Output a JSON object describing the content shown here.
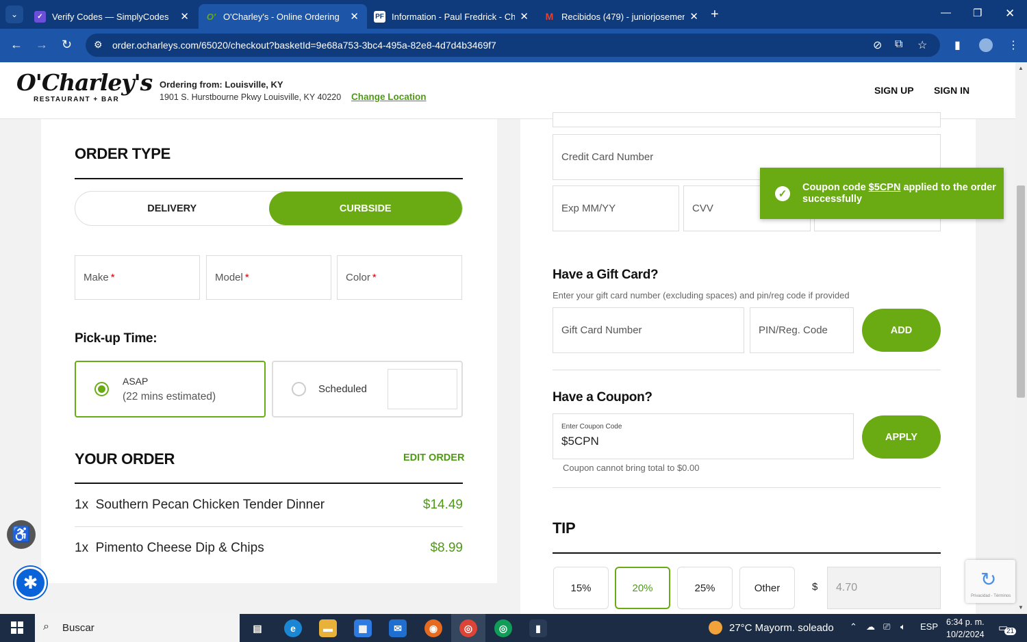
{
  "browser": {
    "tabs": [
      {
        "title": "Verify Codes — SimplyCodes",
        "favicon": "simplycodes-icon",
        "active": false
      },
      {
        "title": "O'Charley's - Online Ordering",
        "favicon": "ocharleys-icon",
        "active": true
      },
      {
        "title": "Information - Paul Fredrick - Ch",
        "favicon": "pf-icon",
        "active": false
      },
      {
        "title": "Recibidos (479) - juniorjosemen",
        "favicon": "gmail-icon",
        "active": false
      }
    ],
    "url": "order.ocharleys.com/65020/checkout?basketId=9e68a753-3bc4-495a-82e8-4d7d4b3469f7"
  },
  "header": {
    "logo_main": "O'Charley's",
    "logo_sub": "RESTAURANT + BAR",
    "ordering_from": "Ordering from: Louisville, KY",
    "address": "1901 S. Hurstbourne Pkwy Louisville, KY 40220",
    "change_location": "Change Location",
    "sign_up": "SIGN UP",
    "sign_in": "SIGN IN"
  },
  "order_type": {
    "title": "ORDER TYPE",
    "delivery": "DELIVERY",
    "curbside": "CURBSIDE",
    "selected": "CURBSIDE",
    "make": "Make",
    "model": "Model",
    "color": "Color",
    "required_mark": "*"
  },
  "pickup": {
    "title": "Pick-up Time:",
    "asap": "ASAP",
    "asap_estimate": "(22 mins estimated)",
    "scheduled": "Scheduled"
  },
  "your_order": {
    "title": "YOUR ORDER",
    "edit": "EDIT ORDER",
    "items": [
      {
        "qty": "1x",
        "name": "Southern Pecan Chicken Tender Dinner",
        "price": "$14.49"
      },
      {
        "qty": "1x",
        "name": "Pimento Cheese Dip & Chips",
        "price": "$8.99"
      }
    ]
  },
  "payment": {
    "card_number": "Credit Card Number",
    "exp": "Exp MM/YY",
    "cvv": "CVV"
  },
  "gift_card": {
    "title": "Have a Gift Card?",
    "desc": "Enter your gift card number (excluding spaces) and pin/reg code if provided",
    "number": "Gift Card Number",
    "pin": "PIN/Reg. Code",
    "add": "ADD"
  },
  "coupon": {
    "title": "Have a Coupon?",
    "field_label": "Enter Coupon Code",
    "value": "$5CPN",
    "apply": "APPLY",
    "note": "Coupon cannot bring total to $0.00"
  },
  "tip": {
    "title": "TIP",
    "options": [
      "15%",
      "20%",
      "25%",
      "Other"
    ],
    "selected": "20%",
    "currency": "$",
    "amount": "4.70"
  },
  "toast": {
    "prefix": "Coupon code ",
    "code": "$5CPN",
    "suffix": " applied to the order successfully"
  },
  "recaptcha": {
    "terms": "Privacidad - Términos"
  },
  "taskbar": {
    "search": "Buscar",
    "weather": "27°C  Mayorm. soleado",
    "lang": "ESP",
    "time": "6:34 p. m.",
    "date": "10/2/2024",
    "notifications": "21"
  },
  "colors": {
    "brand_green": "#6aab14",
    "chrome_dark": "#0f3b7c",
    "chrome_mid": "#1d55a8"
  }
}
